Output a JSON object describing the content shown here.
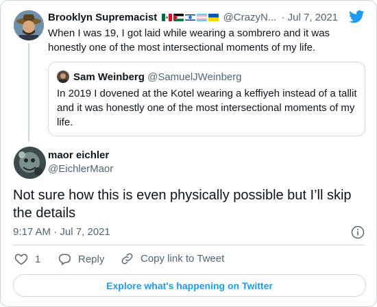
{
  "parent_tweet": {
    "display_name": "Brooklyn Supremacist",
    "flags": [
      "mexico-flag-icon",
      "palestine-flag-icon",
      "israel-flag-icon",
      "transgender-flag-icon",
      "ukraine-flag-icon"
    ],
    "handle": "@CrazyN...",
    "separator": "·",
    "date": "Jul 7, 2021",
    "text": "When I was 19, I got laid while wearing a sombrero and it was honestly one of the most intersectional moments of my life."
  },
  "quoted_tweet": {
    "display_name": "Sam Weinberg",
    "handle": "@SamuelJWeinberg",
    "text": "In 2019 I dovened at the Kotel wearing a keffiyeh instead of a tallit and it was honestly one of the most intersectional moments of my life."
  },
  "reply_tweet": {
    "display_name": "maor eichler",
    "handle": "@EichlerMaor",
    "text": "Not sure how this is even physically possible but I’ll skip the details",
    "timestamp": "9:17 AM · Jul 7, 2021"
  },
  "actions": {
    "like_count": "1",
    "reply_label": "Reply",
    "copy_link_label": "Copy link to Tweet"
  },
  "explore_label": "Explore what's happening on Twitter",
  "colors": {
    "twitter_blue": "#1d9bf0",
    "text_primary": "#0f1419",
    "text_muted": "#536471",
    "border": "#cfd9de"
  }
}
